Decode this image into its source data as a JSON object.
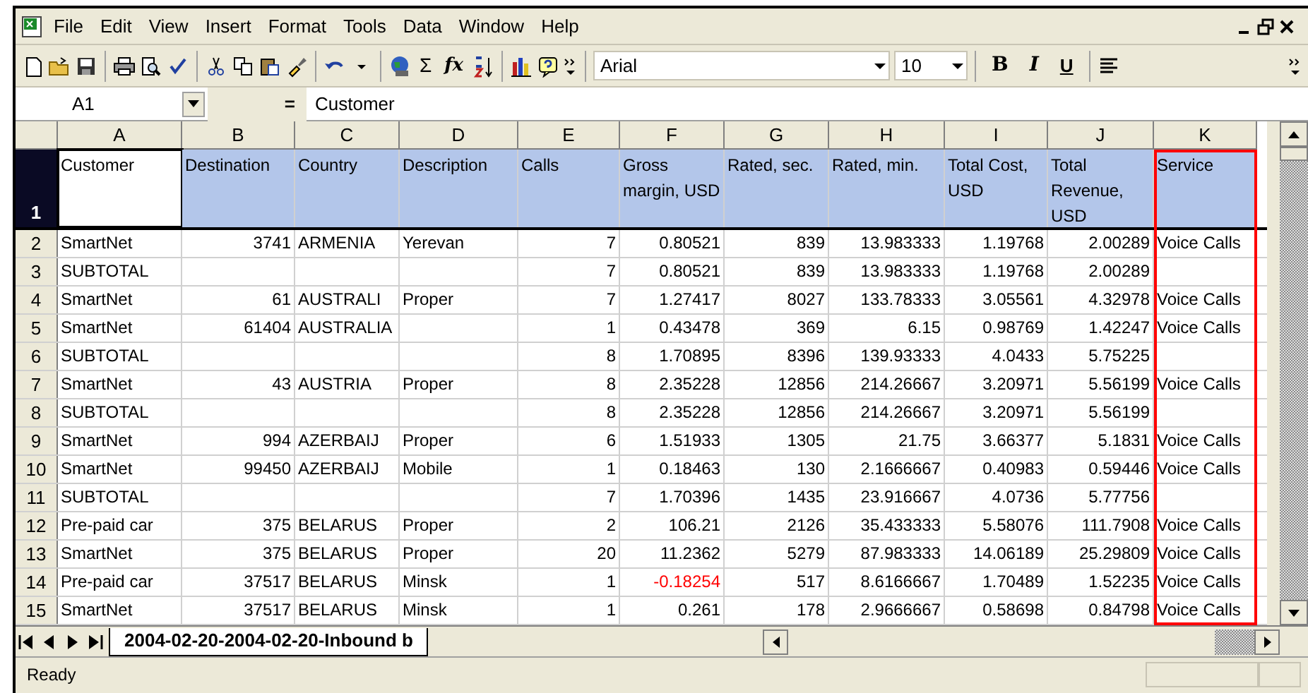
{
  "menu": [
    "File",
    "Edit",
    "View",
    "Insert",
    "Format",
    "Tools",
    "Data",
    "Window",
    "Help"
  ],
  "toolbar": {
    "sum": "Σ",
    "function": "fx",
    "font": "Arial",
    "size": "10",
    "bold": "B",
    "italic": "I",
    "underline": "U"
  },
  "formula_bar": {
    "cell": "A1",
    "equals": "=",
    "value": "Customer"
  },
  "columns": [
    {
      "letter": "A",
      "highlighted": false
    },
    {
      "letter": "B",
      "highlighted": false
    },
    {
      "letter": "C",
      "highlighted": false
    },
    {
      "letter": "D",
      "highlighted": false
    },
    {
      "letter": "E",
      "highlighted": false
    },
    {
      "letter": "F",
      "highlighted": false
    },
    {
      "letter": "G",
      "highlighted": false
    },
    {
      "letter": "H",
      "highlighted": false
    },
    {
      "letter": "I",
      "highlighted": false
    },
    {
      "letter": "J",
      "highlighted": false
    },
    {
      "letter": "K",
      "highlighted": true
    }
  ],
  "rows": [
    {
      "number": "1",
      "selected": true,
      "cells": [
        "Customer",
        "Destination",
        "Country",
        "Description",
        "Calls",
        "Gross margin, USD",
        "Rated, sec.",
        "Rated, min.",
        "Total Cost, USD",
        "Total Revenue, USD",
        "Service"
      ]
    },
    {
      "number": "2",
      "selected": false,
      "cells": [
        "SmartNet",
        "3741",
        "ARMENIA",
        "Yerevan",
        "7",
        "0.80521",
        "839",
        "13.983333",
        "1.19768",
        "2.00289",
        "Voice Calls"
      ]
    },
    {
      "number": "3",
      "selected": false,
      "cells": [
        "SUBTOTAL",
        null,
        null,
        null,
        "7",
        "0.80521",
        "839",
        "13.983333",
        "1.19768",
        "2.00289",
        null
      ]
    },
    {
      "number": "4",
      "selected": false,
      "cells": [
        "SmartNet",
        "61",
        "AUSTRALI",
        "Proper",
        "7",
        "1.27417",
        "8027",
        "133.78333",
        "3.05561",
        "4.32978",
        "Voice Calls"
      ]
    },
    {
      "number": "5",
      "selected": false,
      "cells": [
        "SmartNet",
        "61404",
        "AUSTRALIA",
        null,
        "1",
        "0.43478",
        "369",
        "6.15",
        "0.98769",
        "1.42247",
        "Voice Calls"
      ]
    },
    {
      "number": "6",
      "selected": false,
      "cells": [
        "SUBTOTAL",
        null,
        null,
        null,
        "8",
        "1.70895",
        "8396",
        "139.93333",
        "4.0433",
        "5.75225",
        null
      ]
    },
    {
      "number": "7",
      "selected": false,
      "cells": [
        "SmartNet",
        "43",
        "AUSTRIA",
        "Proper",
        "8",
        "2.35228",
        "12856",
        "214.26667",
        "3.20971",
        "5.56199",
        "Voice Calls"
      ]
    },
    {
      "number": "8",
      "selected": false,
      "cells": [
        "SUBTOTAL",
        null,
        null,
        null,
        "8",
        "2.35228",
        "12856",
        "214.26667",
        "3.20971",
        "5.56199",
        null
      ]
    },
    {
      "number": "9",
      "selected": false,
      "cells": [
        "SmartNet",
        "994",
        "AZERBAIJ",
        "Proper",
        "6",
        "1.51933",
        "1305",
        "21.75",
        "3.66377",
        "5.1831",
        "Voice Calls"
      ]
    },
    {
      "number": "10",
      "selected": false,
      "cells": [
        "SmartNet",
        "99450",
        "AZERBAIJ",
        "Mobile",
        "1",
        "0.18463",
        "130",
        "2.1666667",
        "0.40983",
        "0.59446",
        "Voice Calls"
      ]
    },
    {
      "number": "11",
      "selected": false,
      "cells": [
        "SUBTOTAL",
        null,
        null,
        null,
        "7",
        "1.70396",
        "1435",
        "23.916667",
        "4.0736",
        "5.77756",
        null
      ]
    },
    {
      "number": "12",
      "selected": false,
      "cells": [
        "Pre-paid car",
        "375",
        "BELARUS",
        "Proper",
        "2",
        "106.21",
        "2126",
        "35.433333",
        "5.58076",
        "111.7908",
        "Voice Calls"
      ]
    },
    {
      "number": "13",
      "selected": false,
      "cells": [
        "SmartNet",
        "375",
        "BELARUS",
        "Proper",
        "20",
        "11.2362",
        "5279",
        "87.983333",
        "14.06189",
        "25.29809",
        "Voice Calls"
      ]
    },
    {
      "number": "14",
      "selected": false,
      "cells": [
        "Pre-paid car",
        "37517",
        "BELARUS",
        "Minsk",
        "1",
        {
          "text": "-0.18254",
          "negative": true
        },
        "517",
        "8.6166667",
        "1.70489",
        "1.52235",
        "Voice Calls"
      ]
    },
    {
      "number": "15",
      "selected": false,
      "cells": [
        "SmartNet",
        "37517",
        "BELARUS",
        "Minsk",
        "1",
        "0.261",
        "178",
        "2.9666667",
        "0.58698",
        "0.84798",
        "Voice Calls"
      ]
    }
  ],
  "sheet_tabs": [
    {
      "label": "2004-02-20-2004-02-20-Inbound b",
      "selected": true
    }
  ],
  "status_bar": {
    "text": "Ready"
  }
}
